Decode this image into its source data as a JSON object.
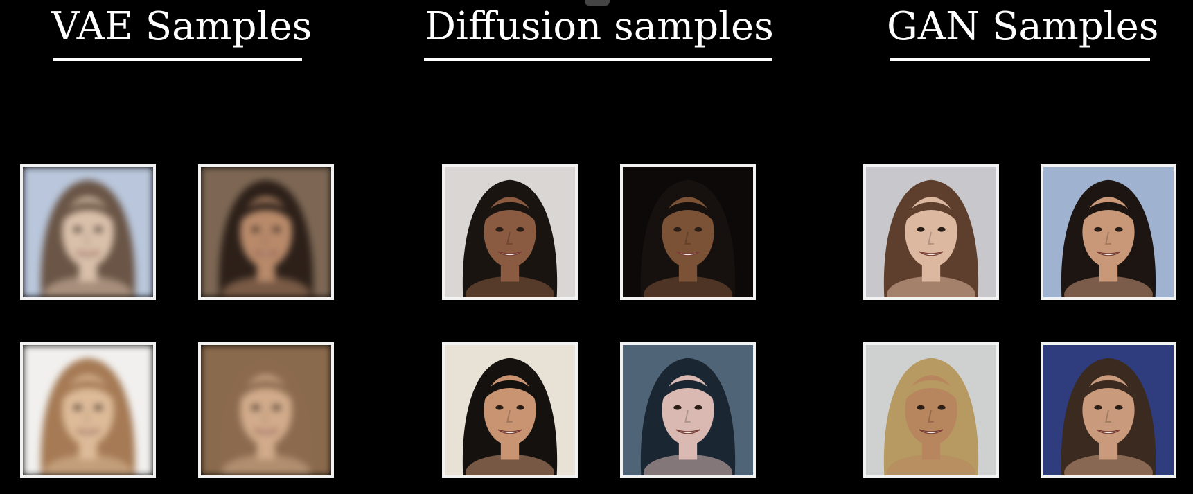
{
  "columns": [
    {
      "title": "VAE Samples",
      "tiles": [
        {
          "bg": "#b9c6db",
          "hair": "#6a5546",
          "skin": "#d8c0aa"
        },
        {
          "bg": "#7d6754",
          "hair": "#2c2019",
          "skin": "#b88a6a"
        },
        {
          "bg": "#f1f0ee",
          "hair": "#a57a54",
          "skin": "#ddbb99"
        },
        {
          "bg": "#8a6a4c",
          "hair": "#8b6a4e",
          "skin": "#d1ab8b"
        }
      ]
    },
    {
      "title": "Diffusion samples",
      "tiles": [
        {
          "bg": "#d9d6d4",
          "hair": "#1a1411",
          "skin": "#8a5b40"
        },
        {
          "bg": "#0c0908",
          "hair": "#16110e",
          "skin": "#7b5236"
        },
        {
          "bg": "#e8e2d6",
          "hair": "#15110f",
          "skin": "#c99472"
        },
        {
          "bg": "#4f6577",
          "hair": "#1b2633",
          "skin": "#d9b9b2"
        }
      ]
    },
    {
      "title": "GAN Samples",
      "tiles": [
        {
          "bg": "#c8c8cc",
          "hair": "#5e3e2c",
          "skin": "#dcb8a0"
        },
        {
          "bg": "#9fb2d0",
          "hair": "#1d1512",
          "skin": "#c99878"
        },
        {
          "bg": "#cfd0d0",
          "hair": "#b79a62",
          "skin": "#b8865e"
        },
        {
          "bg": "#2f3d7e",
          "hair": "#3a2a20",
          "skin": "#c99a7c"
        }
      ]
    }
  ]
}
